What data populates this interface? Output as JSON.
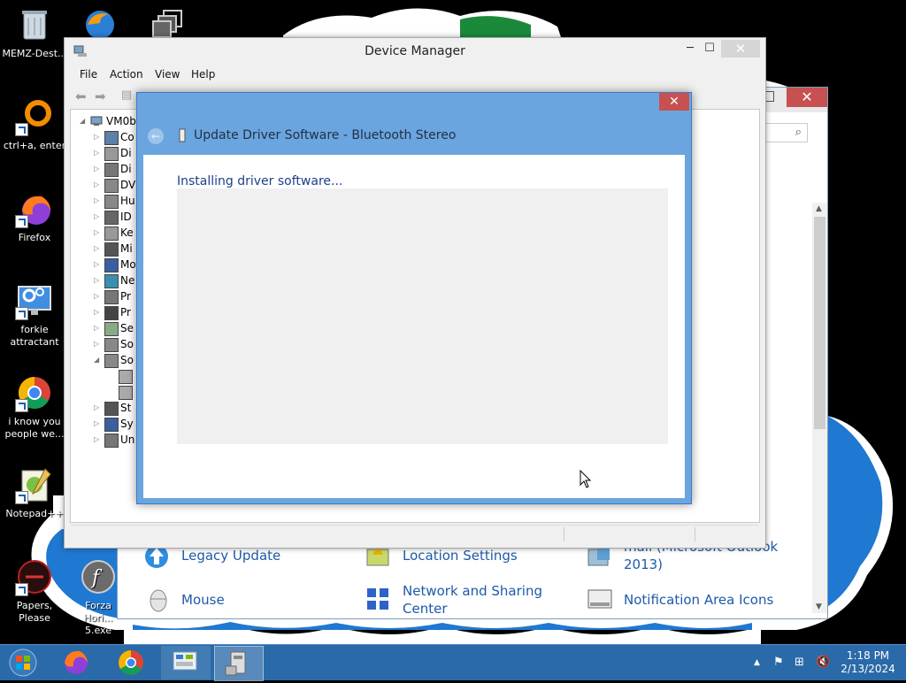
{
  "desktop_icons": [
    {
      "name": "MEMZ-Dest...",
      "icon": "recycle-bin-icon"
    },
    {
      "name": "ctrl+a, enter",
      "icon": "orange-ring-icon"
    },
    {
      "name": "Firefox",
      "icon": "firefox-icon"
    },
    {
      "name": "forkie attractant",
      "icon": "monitor-gear-icon"
    },
    {
      "name": "i know you people we...",
      "icon": "chrome-icon"
    },
    {
      "name": "Notepad++",
      "icon": "notepadpp-icon"
    },
    {
      "name": "Papers, Please",
      "icon": "papers-please-icon"
    },
    {
      "name": "Forza Hori... 5.exe",
      "icon": "flash-icon"
    }
  ],
  "control_panel": {
    "items": [
      {
        "label": "Legacy Update",
        "icon": "legacy-update-icon"
      },
      {
        "label": "Location Settings",
        "icon": "location-settings-icon"
      },
      {
        "label": "mail (Microsoft Outlook 2013)",
        "icon": "mail-icon"
      },
      {
        "label": "Mouse",
        "icon": "mouse-icon"
      },
      {
        "label": "Network and Sharing Center",
        "icon": "network-icon"
      },
      {
        "label": "Notification Area Icons",
        "icon": "notification-area-icon"
      }
    ]
  },
  "device_manager": {
    "title": "Device Manager",
    "menu": [
      "File",
      "Action",
      "View",
      "Help"
    ],
    "tree_root": "VM0b",
    "tree_items": [
      "Co",
      "Di",
      "Di",
      "DV",
      "Hu",
      "ID",
      "Ke",
      "Mi",
      "Mo",
      "Ne",
      "Pr",
      "Pr",
      "Se",
      "So",
      "So",
      "",
      "",
      "St",
      "Sy",
      "Un"
    ]
  },
  "update_dialog": {
    "title": "Update Driver Software - Bluetooth Stereo",
    "status": "Installing driver software...",
    "close": "✕",
    "back": "←"
  },
  "taskbar": {
    "time": "1:18 PM",
    "date": "2/13/2024"
  },
  "colors": {
    "dialog_frame": "#6ba5df",
    "taskbar": "#2a6aa8",
    "link_blue": "#1e5aa8",
    "close_red": "#c75050"
  }
}
